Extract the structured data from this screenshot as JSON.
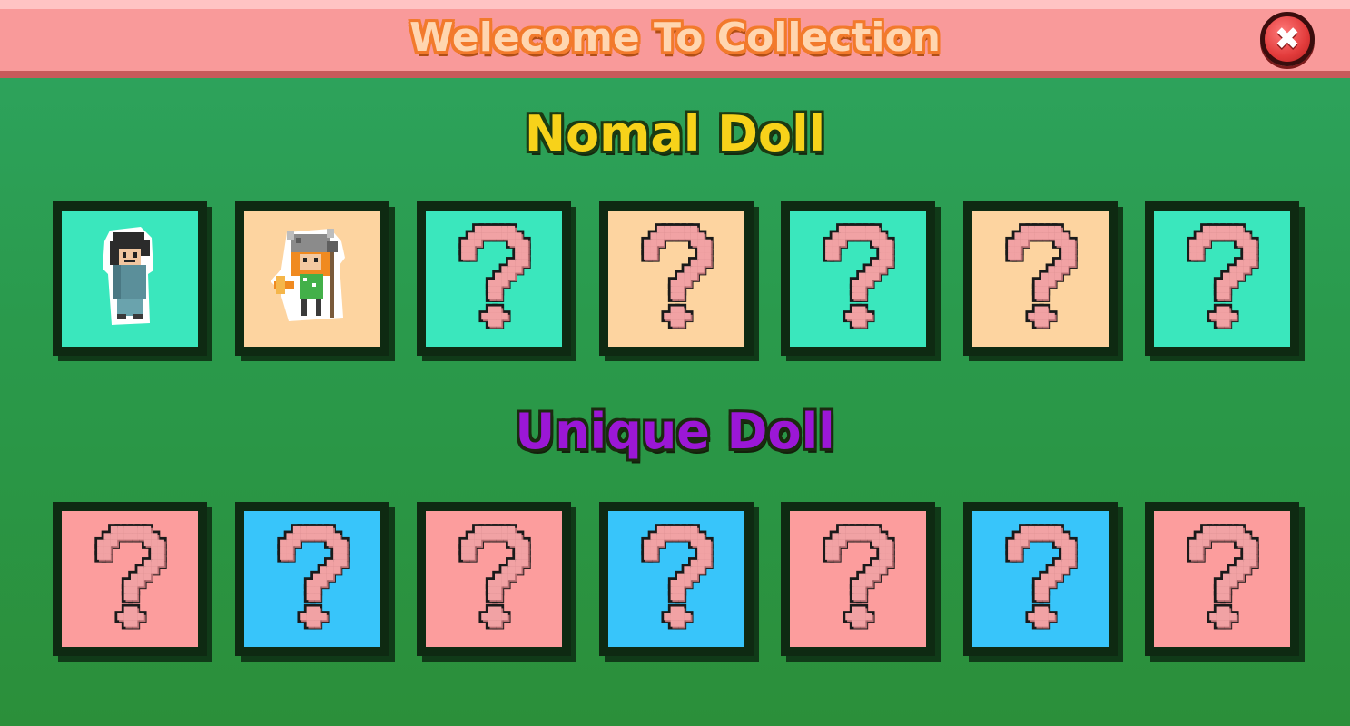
{
  "header": {
    "title": "Welecome To Collection"
  },
  "close_button": {
    "icon": "close-icon"
  },
  "sections": {
    "normal": {
      "title": "Nomal Doll"
    },
    "unique": {
      "title": "Unique Doll"
    }
  },
  "colors": {
    "teal": "#3ae7bd",
    "peach": "#fdd4a0",
    "pink": "#fc9d9d",
    "blue": "#38c5fa",
    "question_mark": "#f1a2a4"
  },
  "normal_slots": [
    {
      "bg": "#3ae7bd",
      "content": "doll-hooded-boy"
    },
    {
      "bg": "#fdd4a0",
      "content": "doll-viking-girl"
    },
    {
      "bg": "#3ae7bd",
      "content": "locked-question-mark"
    },
    {
      "bg": "#fdd4a0",
      "content": "locked-question-mark"
    },
    {
      "bg": "#3ae7bd",
      "content": "locked-question-mark"
    },
    {
      "bg": "#fdd4a0",
      "content": "locked-question-mark"
    },
    {
      "bg": "#3ae7bd",
      "content": "locked-question-mark"
    }
  ],
  "unique_slots": [
    {
      "bg": "#fc9d9d",
      "content": "locked-question-mark"
    },
    {
      "bg": "#38c5fa",
      "content": "locked-question-mark"
    },
    {
      "bg": "#fc9d9d",
      "content": "locked-question-mark"
    },
    {
      "bg": "#38c5fa",
      "content": "locked-question-mark"
    },
    {
      "bg": "#fc9d9d",
      "content": "locked-question-mark"
    },
    {
      "bg": "#38c5fa",
      "content": "locked-question-mark"
    },
    {
      "bg": "#fc9d9d",
      "content": "locked-question-mark"
    }
  ]
}
